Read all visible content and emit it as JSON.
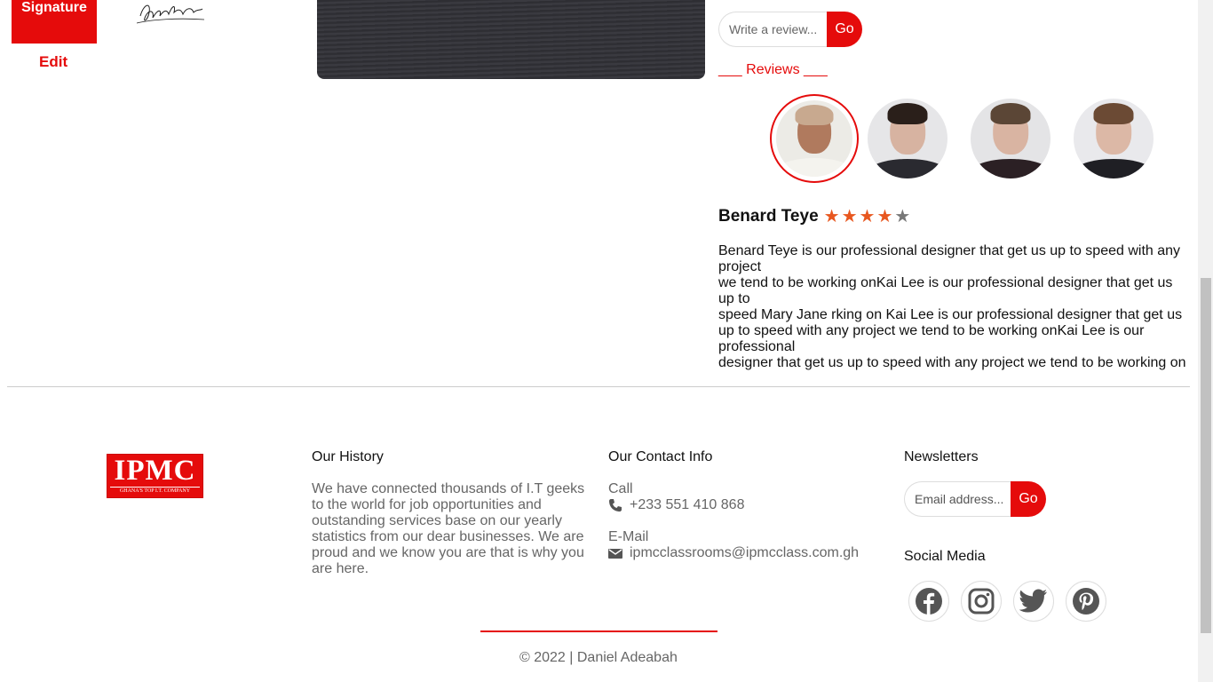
{
  "signature": {
    "label": "Signature",
    "edit_label": "Edit"
  },
  "review_form": {
    "placeholder": "Write a review...",
    "button_label": "Go"
  },
  "reviews": {
    "heading": "___ Reviews ___",
    "avatars": [
      {
        "name": "avatar-1",
        "active": true
      },
      {
        "name": "avatar-2",
        "active": false
      },
      {
        "name": "avatar-3",
        "active": false
      },
      {
        "name": "avatar-4",
        "active": false
      }
    ],
    "reviewer_name": "Benard Teye",
    "rating": 4,
    "rating_max": 5,
    "text_lines": [
      "Benard Teye is our professional designer that get us up to speed with any project",
      "we tend to be working onKai Lee is our professional designer that get us up to",
      "speed Mary Jane rking on Kai Lee is our professional designer that get us up to speed with any project we tend to be working onKai Lee is our professional",
      "designer that get us up to speed with any project we tend to be working on"
    ]
  },
  "footer": {
    "logo_text": "IPMC",
    "logo_sub": "GHANA'S TOP I.T. COMPANY",
    "history": {
      "title": "Our History",
      "text": "We have connected thousands of I.T geeks to the world for job opportunities and outstanding services base on our yearly statistics from our dear businesses. We are proud and we know you are that is why you are here."
    },
    "contact": {
      "title": "Our Contact Info",
      "call_label": "Call",
      "phone": "+233 551 410 868",
      "email_label": "E-Mail",
      "email": "ipmcclassrooms@ipmcclass.com.gh"
    },
    "newsletter": {
      "title": "Newsletters",
      "placeholder": "Email address...",
      "button_label": "Go"
    },
    "social": {
      "title": "Social Media",
      "icons": [
        "facebook-icon",
        "instagram-icon",
        "twitter-icon",
        "pinterest-icon"
      ]
    },
    "copyright": "© 2022 | Daniel Adeabah"
  },
  "colors": {
    "accent": "#e50b0b",
    "star_filled": "#e8571f",
    "star_empty": "#777777",
    "muted_text": "#666666"
  }
}
